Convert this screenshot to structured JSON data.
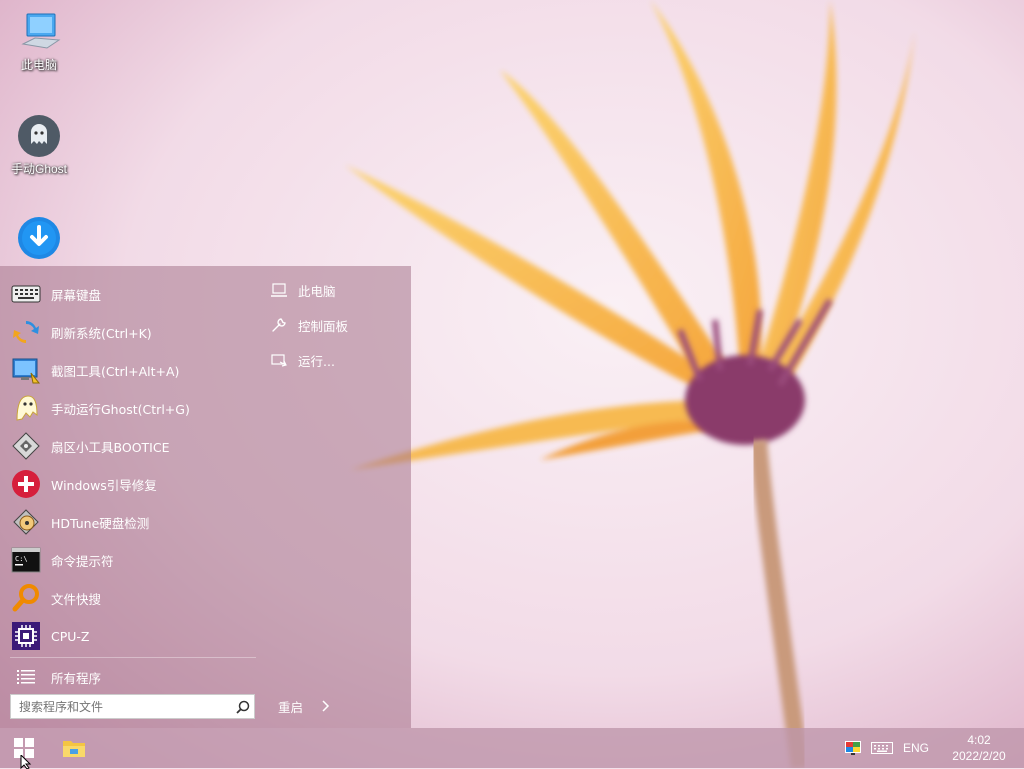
{
  "desktop": {
    "icons": [
      {
        "label": "此电脑",
        "icon": "computer-icon"
      },
      {
        "label": "手动Ghost",
        "icon": "ghost-icon"
      },
      {
        "label": "",
        "icon": "download-icon"
      }
    ]
  },
  "start_menu": {
    "items": [
      {
        "label": "屏幕键盘",
        "icon": "keyboard-icon"
      },
      {
        "label": "刷新系统(Ctrl+K)",
        "icon": "refresh-icon"
      },
      {
        "label": "截图工具(Ctrl+Alt+A)",
        "icon": "screenshot-icon"
      },
      {
        "label": "手动运行Ghost(Ctrl+G)",
        "icon": "ghost-icon"
      },
      {
        "label": "扇区小工具BOOTICE",
        "icon": "disk-tool-icon"
      },
      {
        "label": "Windows引导修复",
        "icon": "repair-icon"
      },
      {
        "label": "HDTune硬盘检测",
        "icon": "hdtune-icon"
      },
      {
        "label": "命令提示符",
        "icon": "cmd-icon"
      },
      {
        "label": "文件快搜",
        "icon": "search-file-icon"
      },
      {
        "label": "CPU-Z",
        "icon": "cpuz-icon"
      }
    ],
    "all_programs": "所有程序",
    "search_placeholder": "搜索程序和文件",
    "right_items": [
      {
        "label": "此电脑",
        "icon": "laptop-icon"
      },
      {
        "label": "控制面板",
        "icon": "wrench-icon"
      },
      {
        "label": "运行...",
        "icon": "run-icon"
      }
    ],
    "restart_label": "重启"
  },
  "taskbar": {
    "language": "ENG",
    "time": "4:02",
    "date": "2022/2/20"
  }
}
